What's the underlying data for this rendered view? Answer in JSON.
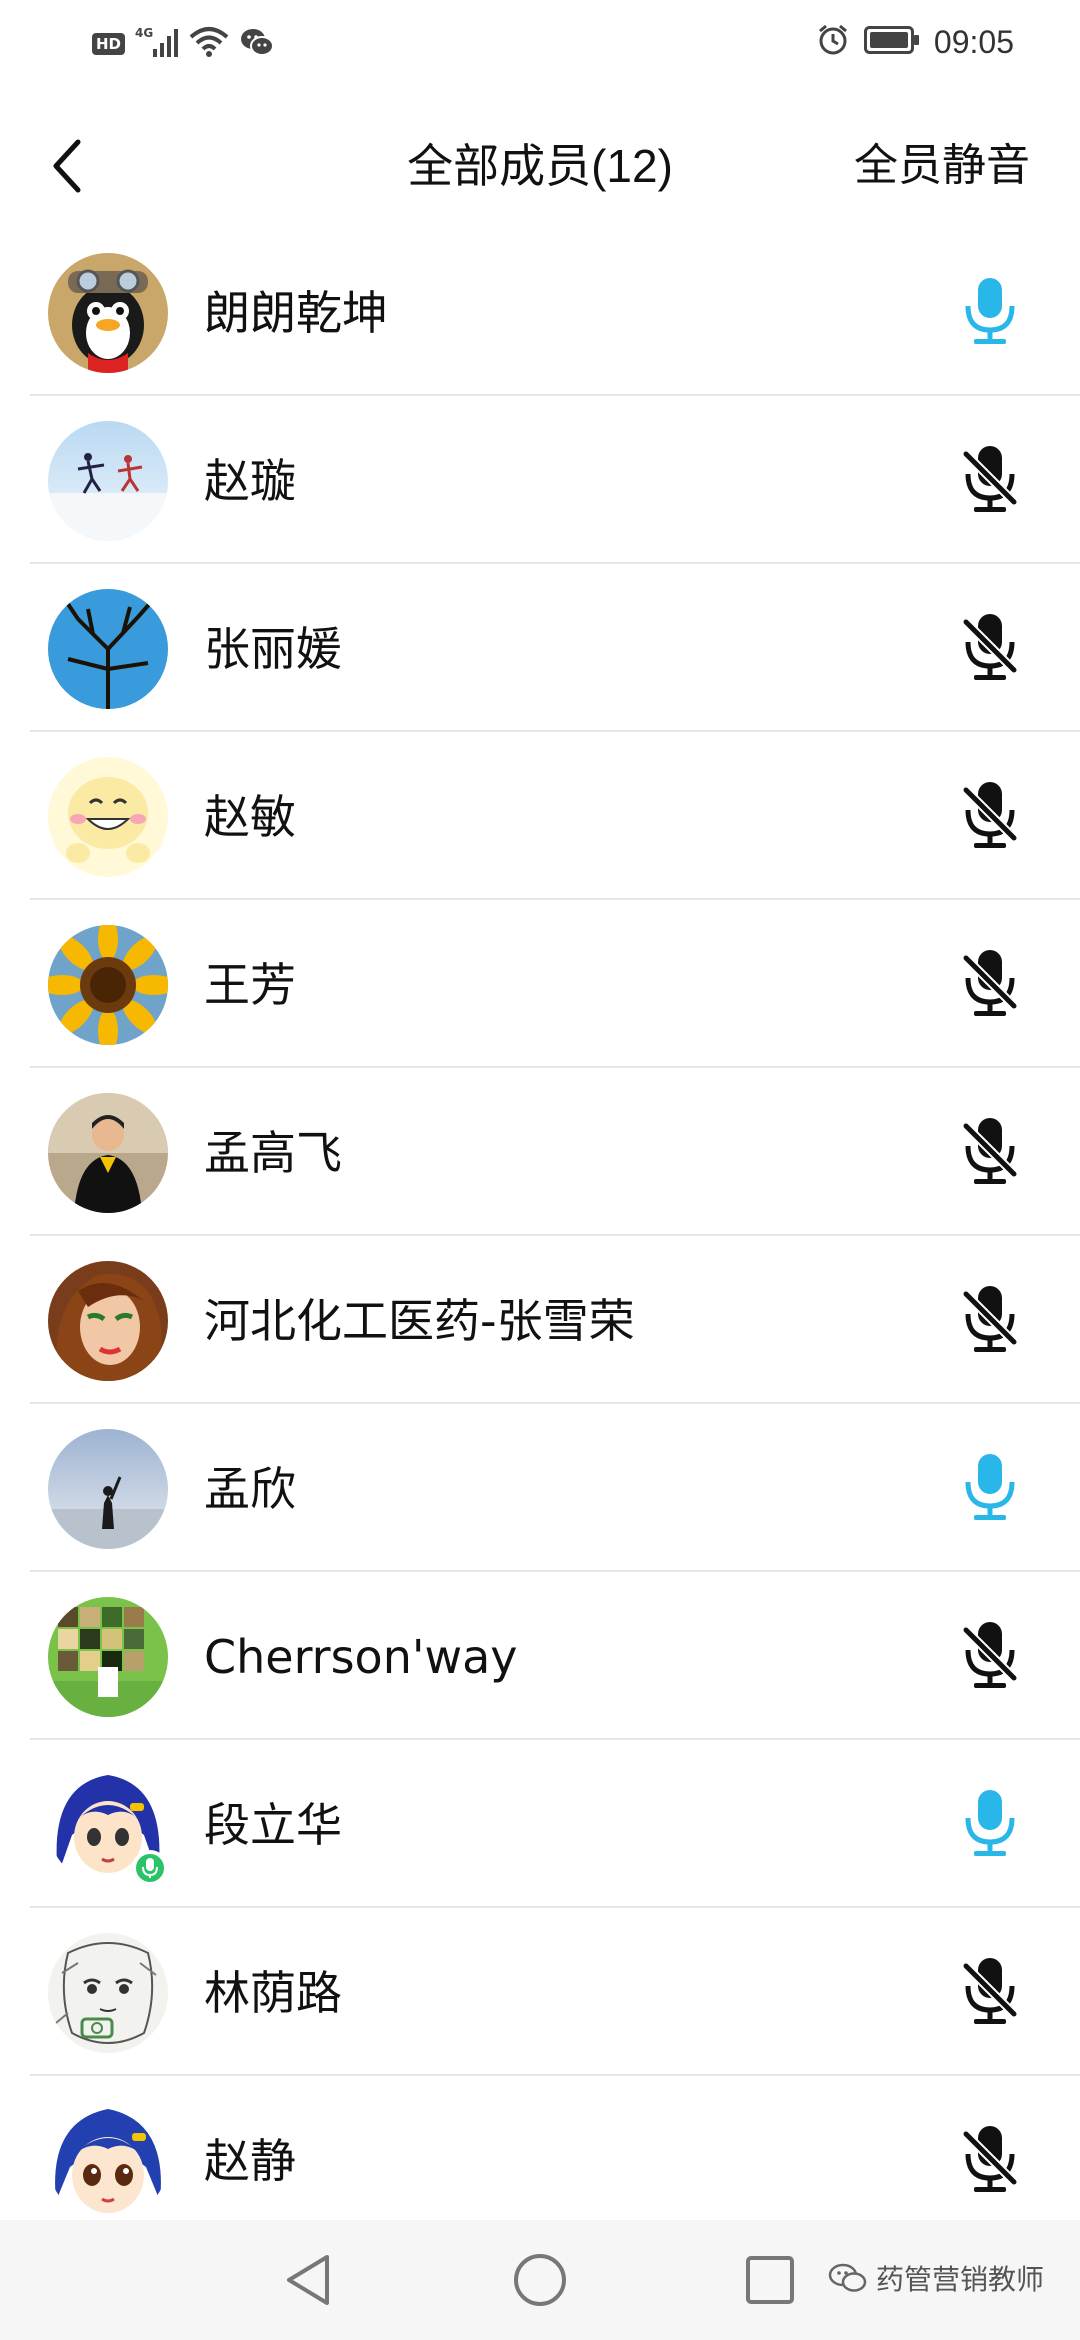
{
  "status_bar": {
    "network": "4G",
    "badge": "HD",
    "time": "09:05"
  },
  "header": {
    "title": "全部成员(12)",
    "mute_all_label": "全员静音"
  },
  "members": [
    {
      "name": "朗朗乾坤",
      "mic": "on",
      "avatar": "penguin"
    },
    {
      "name": "赵璇",
      "mic": "off",
      "avatar": "snow-figures"
    },
    {
      "name": "张丽媛",
      "mic": "off",
      "avatar": "tree-sky"
    },
    {
      "name": "赵敏",
      "mic": "off",
      "avatar": "cartoon-smile"
    },
    {
      "name": "王芳",
      "mic": "off",
      "avatar": "sunflower"
    },
    {
      "name": "孟高飞",
      "mic": "off",
      "avatar": "person-photo"
    },
    {
      "name": "河北化工医药-张雪荣",
      "mic": "off",
      "avatar": "cartoon-girl"
    },
    {
      "name": "孟欣",
      "mic": "on",
      "avatar": "silhouette-lake"
    },
    {
      "name": "Cherrson'way",
      "mic": "off",
      "avatar": "photo-collage"
    },
    {
      "name": "段立华",
      "mic": "on",
      "avatar": "anime-blue",
      "speaking_badge": true
    },
    {
      "name": "林荫路",
      "mic": "off",
      "avatar": "sketch"
    },
    {
      "name": "赵静",
      "mic": "off",
      "avatar": "anime-blue-2"
    }
  ],
  "nav": {
    "watermark": "药管营销教师"
  },
  "colors": {
    "mic_on": "#29b6e8",
    "mic_off": "#111111",
    "divider": "#e6e6e6",
    "speaking": "#2bc36a"
  }
}
